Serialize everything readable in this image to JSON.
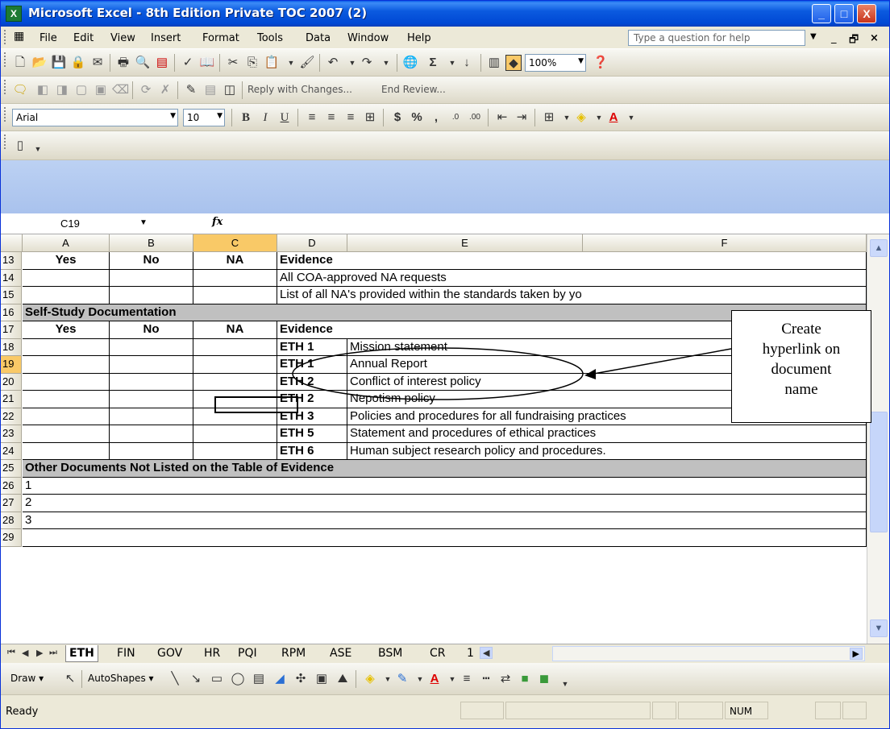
{
  "window": {
    "title": "Microsoft Excel - 8th Edition Private TOC 2007 (2)",
    "controls": [
      "_",
      "□",
      "X"
    ]
  },
  "menubar": {
    "items": [
      "File",
      "Edit",
      "View",
      "Insert",
      "Format",
      "Tools",
      "Data",
      "Window",
      "Help"
    ],
    "help_placeholder": "Type a question for help"
  },
  "reviewing_toolbar": {
    "reply_label": "Reply with Changes...",
    "end_review_label": "End Review..."
  },
  "formatting_toolbar": {
    "font": "Arial",
    "font_size": "10",
    "zoom": "100%"
  },
  "formula_bar": {
    "name_box": "C19",
    "fx": "fx",
    "value": ""
  },
  "columns": [
    "A",
    "B",
    "C",
    "D",
    "E",
    "F"
  ],
  "selected_column": "C",
  "selected_row": "19",
  "rows": [
    {
      "n": "13",
      "a": "Yes",
      "b": "No",
      "c": "NA",
      "d": "Evidence",
      "e": ""
    },
    {
      "n": "14",
      "a": "",
      "b": "",
      "c": "",
      "d": "All COA-approved NA requests",
      "e": ""
    },
    {
      "n": "15",
      "a": "",
      "b": "",
      "c": "",
      "d": "List of all NA's provided within the standards taken by yo",
      "e": ""
    },
    {
      "n": "16",
      "a": "Self-Study Documentation",
      "b": "",
      "c": "",
      "d": "",
      "e": ""
    },
    {
      "n": "17",
      "a": "Yes",
      "b": "No",
      "c": "NA",
      "d": "Evidence",
      "e": ""
    },
    {
      "n": "18",
      "a": "",
      "b": "",
      "c": "",
      "d": "ETH 1",
      "e": "Mission statement"
    },
    {
      "n": "19",
      "a": "",
      "b": "",
      "c": "",
      "d": "ETH 1",
      "e": "Annual Report"
    },
    {
      "n": "20",
      "a": "",
      "b": "",
      "c": "",
      "d": "ETH 2",
      "e": "Conflict of interest policy"
    },
    {
      "n": "21",
      "a": "",
      "b": "",
      "c": "",
      "d": "ETH 2",
      "e": "Nepotism policy"
    },
    {
      "n": "22",
      "a": "",
      "b": "",
      "c": "",
      "d": "ETH 3",
      "e": "Policies and procedures for all fundraising practices"
    },
    {
      "n": "23",
      "a": "",
      "b": "",
      "c": "",
      "d": "ETH 5",
      "e": "Statement and procedures of ethical practices"
    },
    {
      "n": "24",
      "a": "",
      "b": "",
      "c": "",
      "d": "ETH 6",
      "e": "Human subject research policy and procedures."
    },
    {
      "n": "25",
      "a": "Other Documents Not Listed on the Table of Evidence",
      "b": "",
      "c": "",
      "d": "",
      "e": ""
    },
    {
      "n": "26",
      "a": "1",
      "b": "",
      "c": "",
      "d": "",
      "e": ""
    },
    {
      "n": "27",
      "a": "2",
      "b": "",
      "c": "",
      "d": "",
      "e": ""
    },
    {
      "n": "28",
      "a": "3",
      "b": "",
      "c": "",
      "d": "",
      "e": ""
    },
    {
      "n": "29",
      "a": "",
      "b": "",
      "c": "",
      "d": "",
      "e": ""
    }
  ],
  "callout": {
    "line1": "Create",
    "line2": "hyperlink on",
    "line3": "document",
    "line4": "name"
  },
  "sheet_tabs": [
    "ETH",
    "FIN",
    "GOV",
    "HR",
    "PQI",
    "RPM",
    "ASE",
    "BSM",
    "CR",
    "1"
  ],
  "active_tab": "ETH",
  "draw_toolbar": {
    "draw_label": "Draw ▾",
    "autoshapes_label": "AutoShapes ▾"
  },
  "statusbar": {
    "status": "Ready",
    "num": "NUM"
  },
  "colors": {
    "titlebar": "#0a5ce8",
    "selected_header": "#f9c967",
    "section_gray": "#c0c0c0"
  }
}
